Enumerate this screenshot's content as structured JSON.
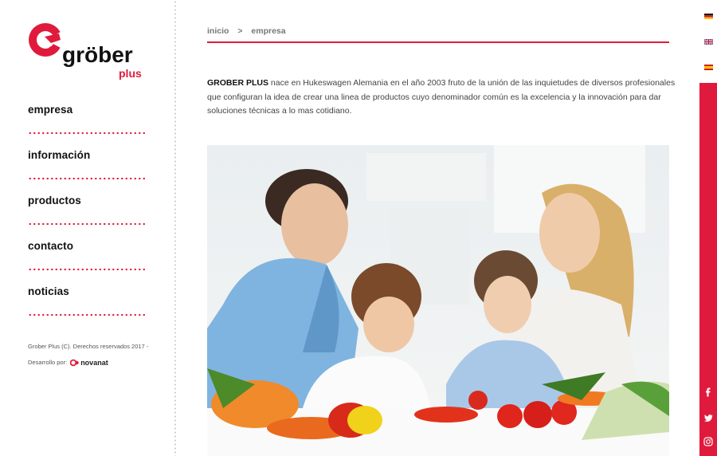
{
  "logo": {
    "word": "gröber",
    "sub": "plus"
  },
  "nav": [
    {
      "label": "empresa"
    },
    {
      "label": "información"
    },
    {
      "label": "productos"
    },
    {
      "label": "contacto"
    },
    {
      "label": "noticias"
    }
  ],
  "footer": {
    "copyright": "Grober Plus (C). Derechos reservados 2017 -",
    "dev_label": "Desarrollo por:",
    "dev_brand": "novanat"
  },
  "breadcrumb": {
    "home": "inicio",
    "separator": ">",
    "current": "empresa"
  },
  "intro": {
    "brand": "GROBER PLUS",
    "text": " nace en Hukeswagen Alemania en el año 2003 fruto de la unión de las inquietudes de diversos profesionales que configuran la idea de crear una linea de productos cuyo denominador común es la excelencia y la innovación para dar soluciones técnicas a lo mas cotidiano."
  },
  "languages": [
    "de",
    "en",
    "es"
  ],
  "social": {
    "facebook": "f",
    "twitter": "t",
    "instagram": "ig"
  },
  "colors": {
    "accent": "#e01a3c"
  }
}
